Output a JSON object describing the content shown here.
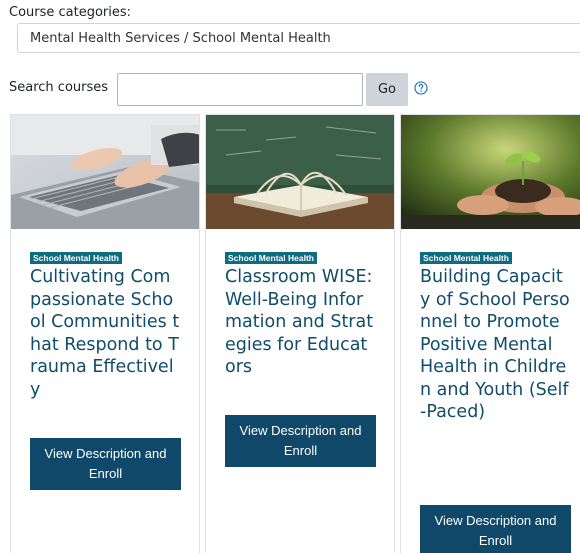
{
  "filter": {
    "category_label": "Course categories:",
    "category_selected": "Mental Health Services / School Mental Health"
  },
  "search": {
    "label": "Search courses",
    "value": "",
    "go_label": "Go",
    "help_icon": "question-circle-icon"
  },
  "colors": {
    "badge": "#0f6b80",
    "title": "#0f4d6b",
    "button": "#0f4869"
  },
  "courses": [
    {
      "image": "laptop-typing-photo",
      "badge": "School Mental Health",
      "title": "Cultivating Compassionate School Communities that Respond to Trauma Effectively",
      "button": "View Description and Enroll"
    },
    {
      "image": "open-book-chalkboard-photo",
      "badge": "School Mental Health",
      "title": "Classroom WISE: Well-Being Information and Strategies for Educators",
      "button": "View Description and Enroll"
    },
    {
      "image": "hands-holding-seedling-photo",
      "badge": "School Mental Health",
      "title": "Building Capacity of School Personnel to Promote Positive Mental Health in Children and Youth (Self-Paced)",
      "button": "View Description and Enroll"
    }
  ]
}
